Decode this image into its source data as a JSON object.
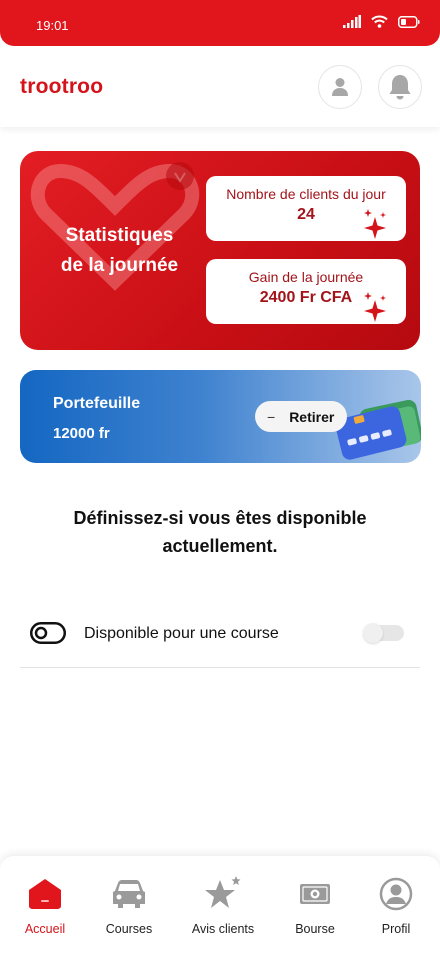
{
  "status_bar": {
    "time": "19:01"
  },
  "header": {
    "logo": "trootroo"
  },
  "stats": {
    "title": "Statistiques\nde la journée",
    "clients_label": "Nombre de clients du jour",
    "clients_value": "24",
    "gain_label": "Gain de la journée",
    "gain_value": "2400 Fr CFA"
  },
  "wallet": {
    "title": "Portefeuille",
    "amount": "12000 fr",
    "withdraw_label": "Retirer",
    "withdraw_icon": "−"
  },
  "availability": {
    "prompt": "Définissez-si vous êtes disponible actuellement.",
    "toggle_label": "Disponible pour une course",
    "toggle_on": false
  },
  "nav": {
    "items": [
      {
        "label": "Accueil",
        "icon": "home-icon",
        "active": true
      },
      {
        "label": "Courses",
        "icon": "car-icon",
        "active": false
      },
      {
        "label": "Avis clients",
        "icon": "star-icon",
        "active": false
      },
      {
        "label": "Bourse",
        "icon": "money-icon",
        "active": false
      },
      {
        "label": "Profil",
        "icon": "profile-icon",
        "active": false
      }
    ]
  },
  "colors": {
    "brand_red": "#e0161c",
    "wallet_blue": "#1467c2",
    "text_dark": "#111111"
  }
}
